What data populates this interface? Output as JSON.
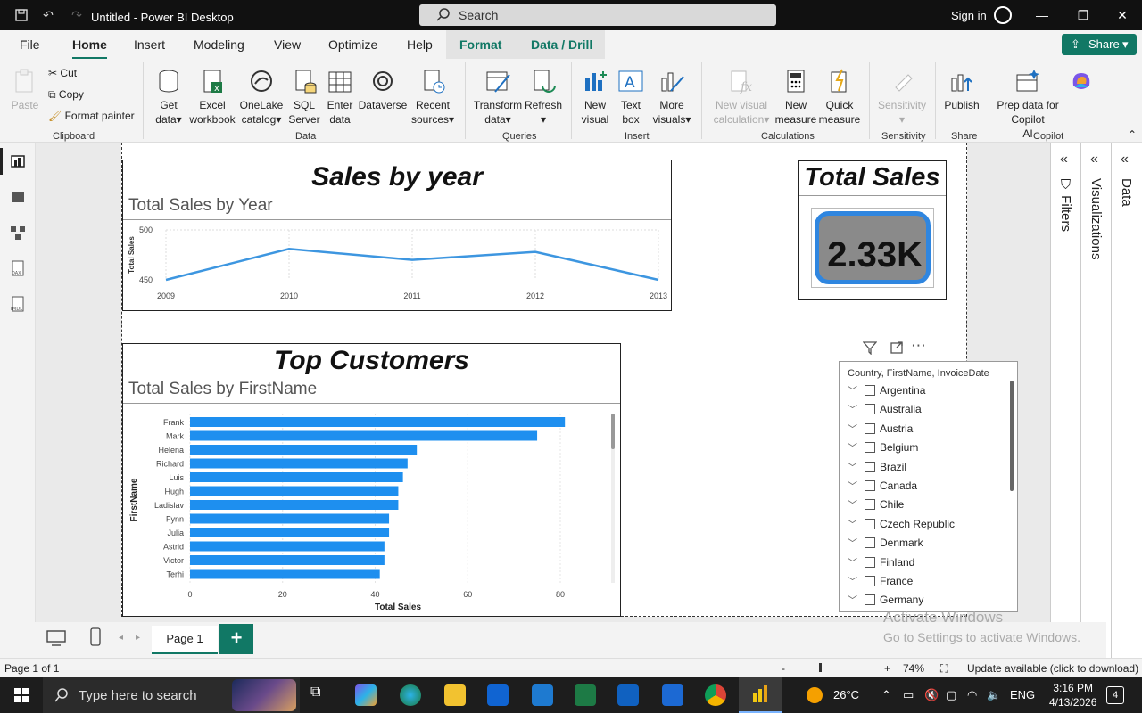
{
  "window": {
    "title": "Untitled - Power BI Desktop",
    "search_placeholder": "Search",
    "signin": "Sign in"
  },
  "menu": {
    "tabs": [
      "File",
      "Home",
      "Insert",
      "Modeling",
      "View",
      "Optimize",
      "Help",
      "Format",
      "Data / Drill"
    ],
    "active": "Home",
    "share": "Share"
  },
  "ribbon": {
    "clipboard": {
      "paste": "Paste",
      "cut": "Cut",
      "copy": "Copy",
      "format_painter": "Format painter",
      "group": "Clipboard"
    },
    "data": {
      "get_data": "Get",
      "get_data2": "data",
      "excel": "Excel",
      "excel2": "workbook",
      "onelake": "OneLake",
      "onelake2": "catalog",
      "sql": "SQL",
      "sql2": "Server",
      "enter": "Enter",
      "enter2": "data",
      "dataverse": "Dataverse",
      "recent": "Recent",
      "recent2": "sources",
      "group": "Data"
    },
    "queries": {
      "transform": "Transform",
      "transform2": "data",
      "refresh": "Refresh",
      "group": "Queries"
    },
    "insert": {
      "new_visual": "New",
      "new_visual2": "visual",
      "text_box": "Text",
      "text_box2": "box",
      "more_visuals": "More",
      "more_visuals2": "visuals",
      "group": "Insert"
    },
    "calculations": {
      "new_visual_calc": "New visual",
      "new_visual_calc2": "calculation",
      "new_measure": "New",
      "new_measure2": "measure",
      "quick_measure": "Quick",
      "quick_measure2": "measure",
      "group": "Calculations"
    },
    "sensitivity": {
      "label": "Sensitivity",
      "group": "Sensitivity"
    },
    "share": {
      "publish": "Publish",
      "group": "Share"
    },
    "copilot": {
      "prep": "Prep data for Copilot",
      "prep2": "AI",
      "group": "Copilot"
    }
  },
  "visuals": {
    "line": {
      "title": "Sales by year",
      "subtitle": "Total Sales by Year"
    },
    "card": {
      "title": "Total Sales",
      "value": "2.33K"
    },
    "bar": {
      "title": "Top Customers",
      "subtitle": "Total Sales by FirstName"
    },
    "slicer": {
      "header": "Country, FirstName, InvoiceDate",
      "items": [
        "Argentina",
        "Australia",
        "Austria",
        "Belgium",
        "Brazil",
        "Canada",
        "Chile",
        "Czech Republic",
        "Denmark",
        "Finland",
        "France",
        "Germany"
      ]
    }
  },
  "chart_data": [
    {
      "type": "line",
      "title": "Total Sales by Year",
      "xlabel": "",
      "ylabel": "Total Sales",
      "x": [
        "2009",
        "2010",
        "2011",
        "2012",
        "2013"
      ],
      "series": [
        {
          "name": "Total Sales",
          "values": [
            450,
            481,
            470,
            478,
            450
          ]
        }
      ],
      "ylim": [
        450,
        500
      ],
      "yticks": [
        "500",
        "450"
      ],
      "color": "#3d96e0"
    },
    {
      "type": "bar",
      "title": "Total Sales by FirstName",
      "xlabel": "Total Sales",
      "ylabel": "FirstName",
      "categories": [
        "Frank",
        "Mark",
        "Helena",
        "Richard",
        "Luis",
        "Hugh",
        "Ladislav",
        "Fynn",
        "Julia",
        "Astrid",
        "Victor",
        "Terhi"
      ],
      "values": [
        81,
        75,
        49,
        47,
        46,
        45,
        45,
        43,
        43,
        42,
        42,
        41
      ],
      "xlim": [
        0,
        90
      ],
      "xticks": [
        "0",
        "20",
        "40",
        "60",
        "80"
      ],
      "color": "#1e8fef"
    }
  ],
  "panes": {
    "filters": "Filters",
    "visualizations": "Visualizations",
    "data": "Data"
  },
  "pages": {
    "current": "Page 1"
  },
  "status": {
    "page": "Page 1 of 1",
    "zoom": "74%",
    "update": "Update available (click to download)"
  },
  "watermark": {
    "line1": "Activate Windows",
    "line2": "Go to Settings to activate Windows."
  },
  "taskbar": {
    "search": "Type here to search",
    "temp": "26°C",
    "lang": "ENG",
    "time": "3:16 PM",
    "date": "4/13/2026",
    "notif": "4"
  }
}
